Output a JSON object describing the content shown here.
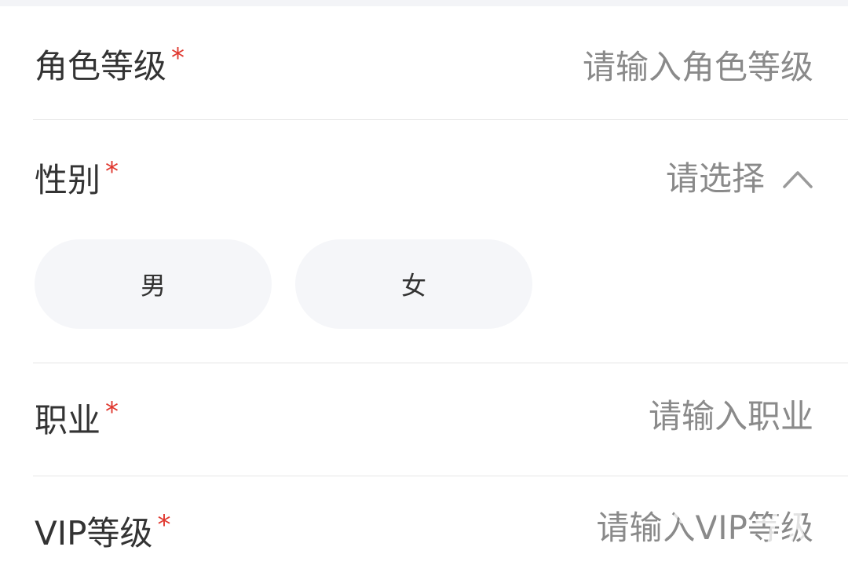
{
  "form": {
    "required_mark": "*",
    "role_level": {
      "label": "角色等级",
      "placeholder": "请输入角色等级"
    },
    "gender": {
      "label": "性别",
      "select_placeholder": "请选择",
      "options": [
        {
          "label": "男"
        },
        {
          "label": "女"
        }
      ]
    },
    "profession": {
      "label": "职业",
      "placeholder": "请输入职业"
    },
    "vip_level": {
      "label": "VIP等级",
      "placeholder": "请输入VIP等级"
    }
  },
  "icons": {
    "chevron": "chevron-up-icon"
  },
  "colors": {
    "required": "#e0382f",
    "label": "#333333",
    "placeholder": "#8a8a8a",
    "option_bg": "#f5f6f9",
    "divider": "#e6e6e6"
  }
}
